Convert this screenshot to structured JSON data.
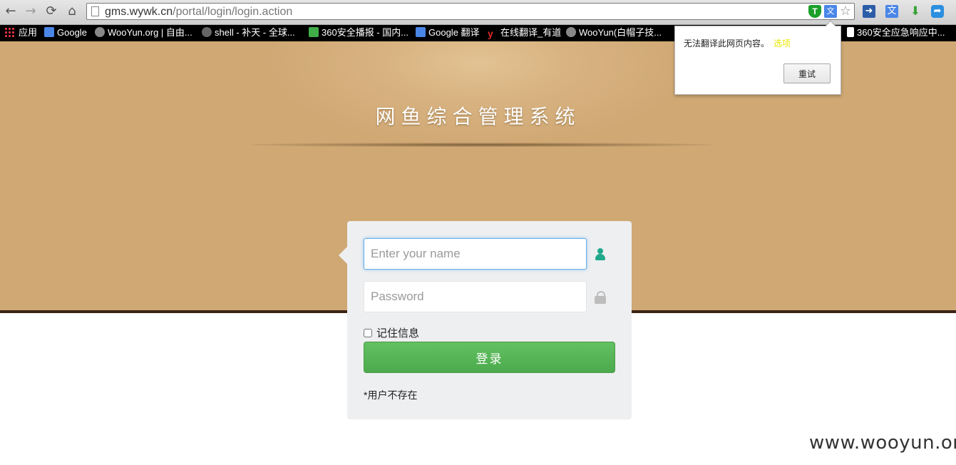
{
  "browser": {
    "url_host": "gms.wywk.cn",
    "url_path": "/portal/login/login.action",
    "nav": {
      "back": "←",
      "forward": "→",
      "reload": "⟳",
      "home": "⌂"
    },
    "icons": [
      "shield-icon",
      "translate-icon",
      "bookmark-star-icon"
    ],
    "extensions": [
      "extension-arrow-icon",
      "extension-translate-icon",
      "download-icon",
      "extension-share-icon"
    ]
  },
  "bookmarks": [
    {
      "label": "应用",
      "icon": "apps-icon"
    },
    {
      "label": "Google",
      "icon": "google-icon"
    },
    {
      "label": "WooYun.org | 自由...",
      "icon": "wooyun-icon"
    },
    {
      "label": "shell - 补天 - 全球...",
      "icon": "butian-icon"
    },
    {
      "label": "360安全播报 - 国内...",
      "icon": "360-icon"
    },
    {
      "label": "Google 翻译",
      "icon": "google-translate-icon"
    },
    {
      "label": "在线翻译_有道",
      "icon": "youdao-icon"
    },
    {
      "label": "WooYun(白帽子技...",
      "icon": "wooyun-icon"
    },
    {
      "label": "360安全应急响应中...",
      "icon": "page-icon"
    }
  ],
  "translate_popup": {
    "message": "无法翻译此网页内容。",
    "link": "选项",
    "retry_label": "重试"
  },
  "banner": {
    "title": "网鱼综合管理系统"
  },
  "login": {
    "username_placeholder": "Enter your name",
    "password_placeholder": "Password",
    "remember_label": "记住信息",
    "submit_label": "登录",
    "error_message": "*用户不存在"
  },
  "watermark": "www.wooyun.org",
  "colors": {
    "banner": "#cfa874",
    "login_button": "#5cb85c",
    "user_icon": "#1fa98a",
    "panel": "#eeeff1"
  }
}
